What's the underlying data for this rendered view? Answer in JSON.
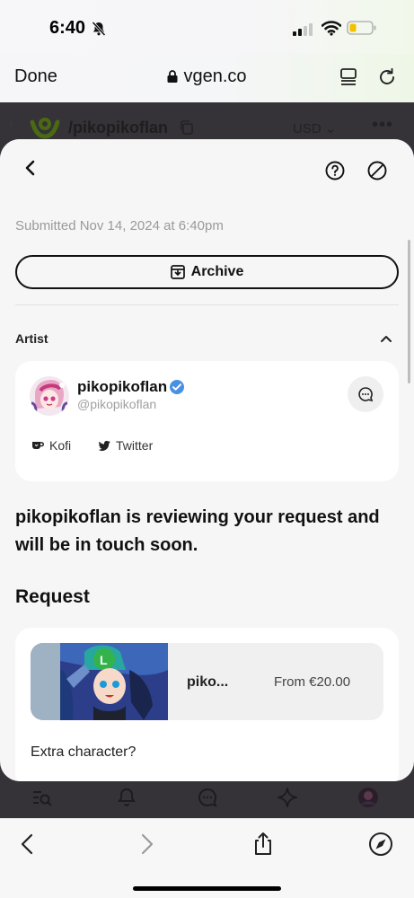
{
  "status_bar": {
    "time": "6:40"
  },
  "browser": {
    "done_label": "Done",
    "url": "vgen.co"
  },
  "page_behind": {
    "username": "/pikopikoflan",
    "currency": "USD",
    "more": "•••"
  },
  "commission": {
    "submitted": "Submitted Nov 14, 2024 at 6:40pm",
    "archive_label": "Archive",
    "artist_section_label": "Artist",
    "artist": {
      "name": "pikopikoflan",
      "handle": "@pikopikoflan",
      "links": [
        {
          "label": "Kofi",
          "icon": "kofi-icon"
        },
        {
          "label": "Twitter",
          "icon": "twitter-icon"
        }
      ]
    },
    "status_message": "pikopikoflan is reviewing your request and will be in touch soon.",
    "request_heading": "Request",
    "request": {
      "product_name": "piko...",
      "price": "From €20.00",
      "extra_label": "Extra character?"
    }
  },
  "colors": {
    "verified": "#4a90e2",
    "sheet_bg": "#f6f6f6",
    "overlay": "#353238",
    "accent_green": "#6bb500"
  }
}
